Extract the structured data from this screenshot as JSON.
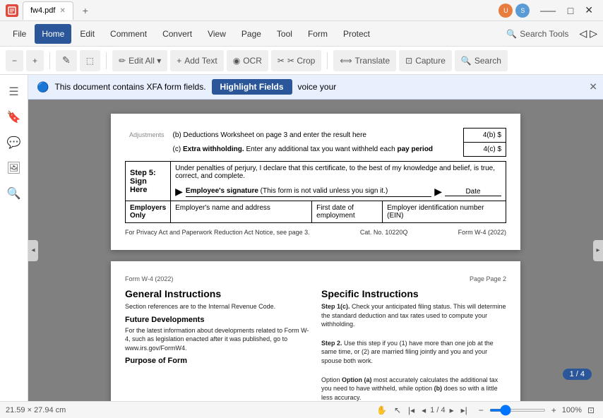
{
  "titlebar": {
    "app_name": "fw4.pdf",
    "tab_label": "fw4.pdf",
    "new_tab_label": "+",
    "minimize": "—",
    "maximize": "□",
    "close": "✕"
  },
  "menubar": {
    "items": [
      "File",
      "Edit",
      "Comment",
      "Convert",
      "View",
      "Page",
      "Tool",
      "Form",
      "Protect"
    ],
    "active": "Home",
    "search_tools_label": "Search Tools"
  },
  "toolbar": {
    "items": [
      {
        "label": "−",
        "name": "zoom-out"
      },
      {
        "label": "+",
        "name": "zoom-in"
      },
      {
        "label": "✎",
        "name": "hand-tool"
      },
      {
        "label": "⬚",
        "name": "select-tool"
      },
      {
        "label": "✏ Edit All ▾",
        "name": "edit-all"
      },
      {
        "label": "+ Add Text",
        "name": "add-text"
      },
      {
        "label": "◉ OCR",
        "name": "ocr"
      },
      {
        "label": "✂ Crop",
        "name": "crop"
      },
      {
        "label": "⟺ Translate",
        "name": "translate"
      },
      {
        "label": "⊡ Capture",
        "name": "capture"
      },
      {
        "label": "⌕ Search",
        "name": "search"
      }
    ]
  },
  "sidebar": {
    "icons": [
      "☰",
      "🔖",
      "💬",
      "🖼",
      "🔍"
    ]
  },
  "notification": {
    "text": "This document contains XFA form fields.",
    "button_label": "Highlight Fields",
    "close": "✕"
  },
  "pdf_page1": {
    "step5": {
      "label": "Step 5:",
      "sublabel": "Sign Here",
      "description": "Under penalties of perjury, I declare that this certificate, to the best of my knowledge and belief, is true, correct, and complete.",
      "sig_label": "Employee's signature",
      "sig_note": "(This form is not valid unless you sign it.)",
      "date_label": "Date",
      "employer_section": {
        "label": "Employers Only",
        "name_label": "Employer's name and address",
        "first_date_label": "First date of employment",
        "ein_label": "Employer identification number (EIN)"
      }
    },
    "adjustments": {
      "label": "Adjustments",
      "row_b": {
        "label": "(b)",
        "text": "Deductions Worksheet on page 3 and enter the result here",
        "ref": "4(b) $"
      },
      "row_c": {
        "label": "(c)",
        "bold_text": "Extra withholding.",
        "text": "Enter any additional tax you want withheld each",
        "bold_end": "pay period",
        "ref": "4(c) $"
      }
    },
    "privacy": {
      "left": "For Privacy Act and Paperwork Reduction Act Notice, see page 3.",
      "cat": "Cat. No. 10220Q",
      "form": "Form W-4 (2022)"
    }
  },
  "pdf_page2": {
    "header_left": "Form W-4 (2022)",
    "header_right": "Page 2",
    "main_title": "General Instructions",
    "intro": "Section references are to the Internal Revenue Code.",
    "future_dev": {
      "title": "Future Developments",
      "text": "For the latest information about developments related to Form W-4, such as legislation enacted after it was published, go to www.irs.gov/FormW4."
    },
    "purpose": {
      "title": "Purpose of Form"
    },
    "specific": {
      "title": "Specific Instructions",
      "step1c": {
        "bold": "Step 1(c).",
        "text": "Check your anticipated filing status. This will determine the standard deduction and tax rates used to compute your withholding."
      },
      "step2": {
        "bold": "Step 2.",
        "text": "Use this step if you (1) have more than one job at the same time, or (2) are married filing jointly and you and your spouse both work."
      },
      "optionA": {
        "bold": "Option (a)",
        "text": "most accurately calculates the additional tax you need to have withheld, while option"
      },
      "optionB": {
        "bold": "(b)",
        "text": "does so with a little less accuracy."
      }
    }
  },
  "status_bar": {
    "dimensions": "21.59 × 27.94 cm",
    "page_current": "1",
    "page_total": "4",
    "page_display": "1 / 4",
    "zoom": "100%",
    "page_badge": "1 / 4"
  }
}
